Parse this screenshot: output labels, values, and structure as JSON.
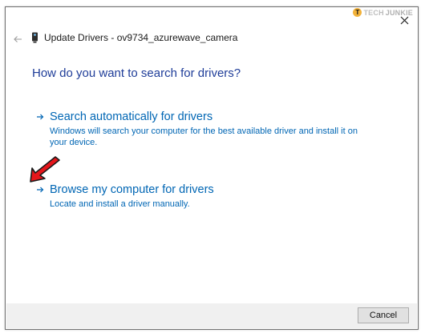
{
  "watermark": {
    "part_a": "TECH",
    "part_b": "JUNKIE",
    "badge": "T"
  },
  "dialog": {
    "title": "Update Drivers - ov9734_azurewave_camera",
    "heading": "How do you want to search for drivers?",
    "options": [
      {
        "label": "Search automatically for drivers",
        "description": "Windows will search your computer for the best available driver and install it on your device."
      },
      {
        "label": "Browse my computer for drivers",
        "description": "Locate and install a driver manually."
      }
    ],
    "cancel_label": "Cancel"
  },
  "icons": {
    "back": "back-arrow-icon",
    "device": "webcam-device-icon",
    "close": "close-icon",
    "option_arrow": "right-arrow-icon",
    "annotation": "red-pointer-arrow-icon"
  },
  "colors": {
    "heading": "#1f3d99",
    "link": "#0066b4",
    "annotation_arrow": "#e5161b",
    "footer": "#f0f0f0"
  }
}
